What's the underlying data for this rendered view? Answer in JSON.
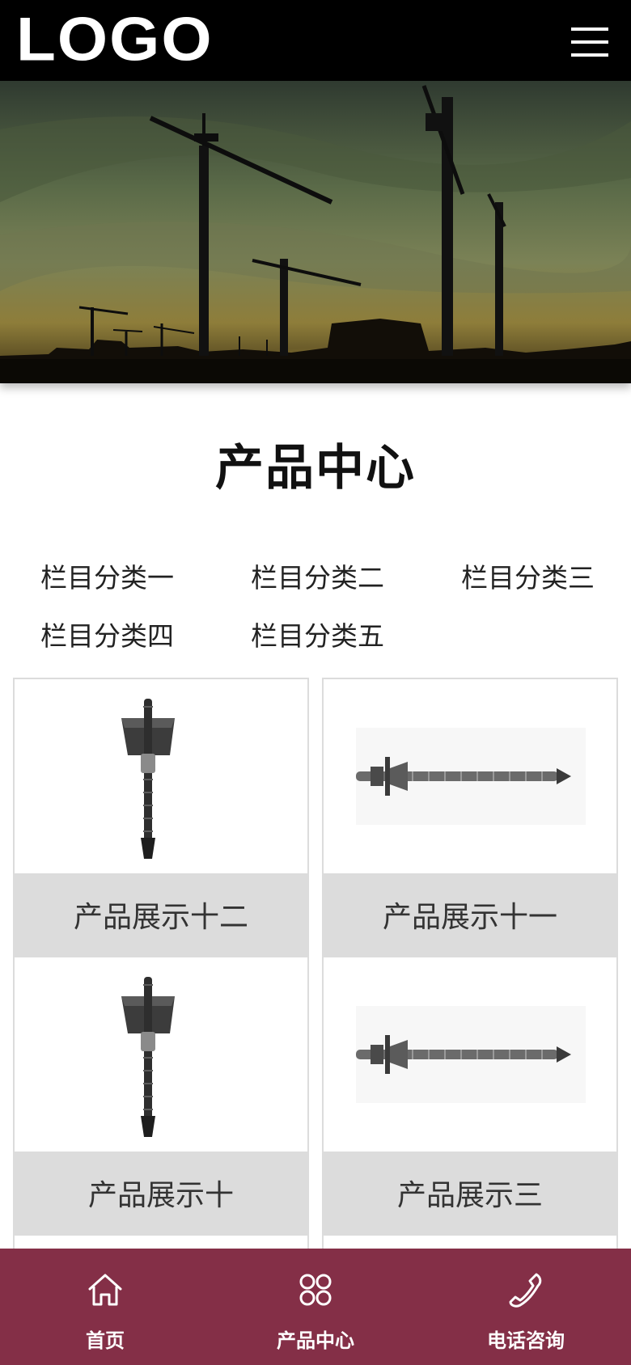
{
  "header": {
    "logo_text": "LOGO",
    "menu_icon": "hamburger-menu-icon"
  },
  "banner": {
    "image": "construction-cranes-sunset-photo"
  },
  "section": {
    "title": "产品中心"
  },
  "categories": [
    {
      "label": "栏目分类一"
    },
    {
      "label": "栏目分类二"
    },
    {
      "label": "栏目分类三"
    },
    {
      "label": "栏目分类四"
    },
    {
      "label": "栏目分类五"
    }
  ],
  "products": [
    {
      "caption": "产品展示十二",
      "image": "vertical-anchor-bolt-with-plate"
    },
    {
      "caption": "产品展示十一",
      "image": "horizontal-anchor-bolt"
    },
    {
      "caption": "产品展示十",
      "image": "vertical-anchor-bolt-with-plate"
    },
    {
      "caption": "产品展示三",
      "image": "horizontal-anchor-bolt"
    }
  ],
  "bottom_nav": [
    {
      "label": "首页",
      "icon": "home-icon"
    },
    {
      "label": "产品中心",
      "icon": "grid-icon"
    },
    {
      "label": "电话咨询",
      "icon": "phone-icon"
    }
  ],
  "colors": {
    "header_bg": "#000000",
    "nav_bg": "#842f47",
    "caption_bg": "#dcdcdc"
  }
}
